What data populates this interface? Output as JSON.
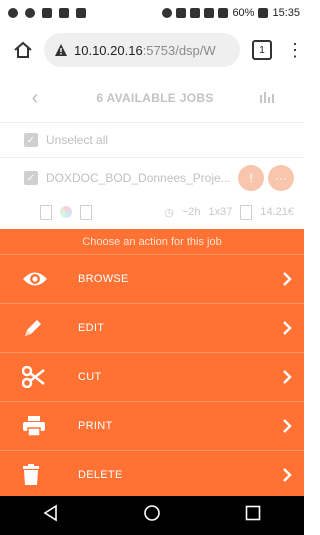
{
  "status_bar": {
    "battery": "60%",
    "time": "15:35"
  },
  "browser": {
    "url_host": "10.10.20.16",
    "url_path": ":5753/dsp/W",
    "tab_count": "1"
  },
  "app": {
    "title": "6 AVAILABLE JOBS",
    "unselect_label": "Unselect all",
    "job": {
      "name": "DOXDOC_BOD_Donnees_Proje...",
      "duration": "~2h",
      "copies": "1x37",
      "price": "14.21€"
    }
  },
  "sheet": {
    "header": "Choose an action for this job",
    "actions": [
      {
        "label": "BROWSE",
        "icon": "eye-icon"
      },
      {
        "label": "EDIT",
        "icon": "pencil-icon"
      },
      {
        "label": "CUT",
        "icon": "scissors-icon"
      },
      {
        "label": "PRINT",
        "icon": "printer-icon"
      },
      {
        "label": "DELETE",
        "icon": "trash-icon"
      }
    ]
  },
  "colors": {
    "accent": "#ff7234",
    "navbar": "#000000"
  }
}
